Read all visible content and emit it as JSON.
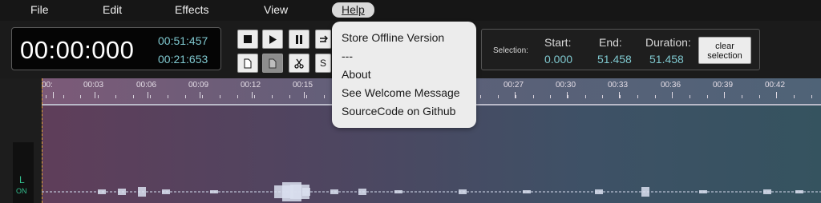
{
  "menubar": {
    "items": [
      "File",
      "Edit",
      "Effects",
      "View"
    ],
    "help": "Help"
  },
  "time": {
    "main_value": "00:00:000",
    "secondary_a": "00:51:457",
    "secondary_b": "00:21:653"
  },
  "toolbar": {
    "partial_button_glyph": "S"
  },
  "selection": {
    "label": "Selection:",
    "start_label": "Start:",
    "start_value": "0.000",
    "end_label": "End:",
    "end_value": "51.458",
    "duration_label": "Duration:",
    "duration_value": "51.458",
    "clear_line1": "clear",
    "clear_line2": "selection"
  },
  "help_menu": {
    "items": [
      "Store Offline Version",
      "---",
      "About",
      "See Welcome Message",
      "SourceCode on Github"
    ]
  },
  "ruler": {
    "labels": [
      "00:",
      "00:03",
      "00:06",
      "00:09",
      "00:12",
      "00:15",
      "00:27",
      "00:30",
      "00:33",
      "00:36",
      "00:39",
      "00:42"
    ]
  },
  "channel": {
    "name": "L",
    "status": "ON"
  },
  "icons": {
    "stop": "stop-icon",
    "play": "play-icon",
    "pause": "pause-icon",
    "loop": "loop-icon",
    "new": "new-file-icon",
    "save": "save-icon",
    "cut": "scissors-icon"
  },
  "colors": {
    "time_secondary": "#7fc8cf",
    "channel_active": "#33c08f",
    "cursor": "#e3a23b"
  }
}
